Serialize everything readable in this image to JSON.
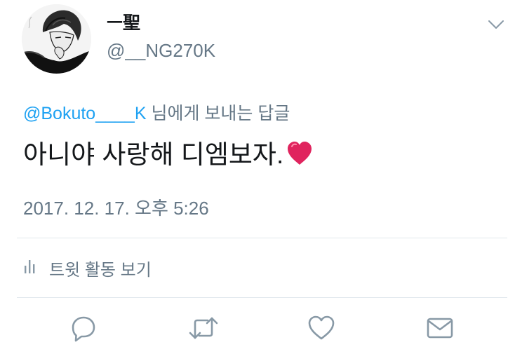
{
  "tweet": {
    "display_name": "ㅡ聖",
    "handle": "@__NG270K",
    "reply_prefix": "@Bokuto____K",
    "reply_suffix": " 님에게 보내는 답글",
    "text": "아니야 사랑해 디엠보자.",
    "emoji": "heart-emoji",
    "timestamp": "2017. 12. 17. 오후 5:26",
    "activity_label": "트윗 활동 보기"
  },
  "icons": {
    "menu": "chevron-down-icon",
    "activity": "bar-chart-icon",
    "reply": "reply-icon",
    "retweet": "retweet-icon",
    "like": "heart-icon",
    "dm": "envelope-icon"
  },
  "colors": {
    "text": "#14171a",
    "secondary": "#657786",
    "mention": "#1da1f2",
    "divider": "#e1e8ed",
    "heart": "#e0245e"
  }
}
